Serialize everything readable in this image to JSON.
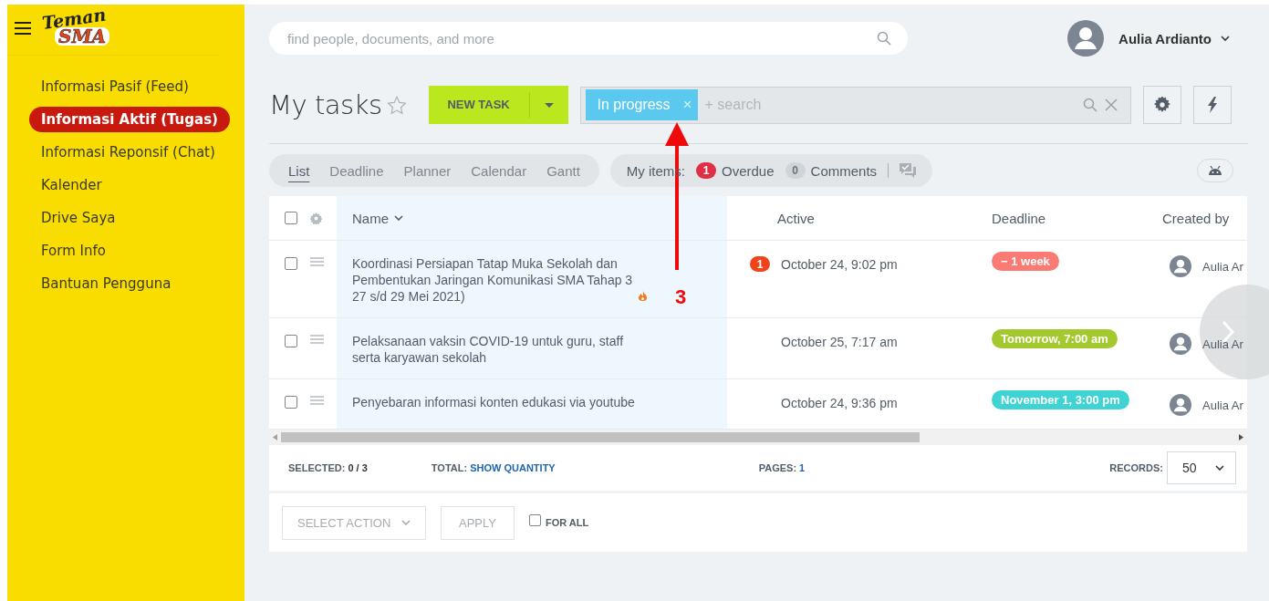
{
  "logo": {
    "line_1": "Teman",
    "line_2": "SMA"
  },
  "sidebar": {
    "items": [
      {
        "label": "Informasi Pasif (Feed)",
        "selected": false
      },
      {
        "label": "Informasi Aktif (Tugas)",
        "selected": true
      },
      {
        "label": "Informasi Reponsif (Chat)",
        "selected": false
      },
      {
        "label": "Kalender",
        "selected": false
      },
      {
        "label": "Drive Saya",
        "selected": false
      },
      {
        "label": "Form Info",
        "selected": false
      },
      {
        "label": "Bantuan Pengguna",
        "selected": false
      }
    ]
  },
  "search": {
    "placeholder": "find people, documents, and more"
  },
  "user": {
    "name": "Aulia Ardianto"
  },
  "page_title": "My tasks",
  "new_task_button": "NEW TASK",
  "filter": {
    "chip": "In progress",
    "chip_close": "×",
    "placeholder": "+ search"
  },
  "view_tabs": [
    {
      "label": "List",
      "selected": true
    },
    {
      "label": "Deadline",
      "selected": false
    },
    {
      "label": "Planner",
      "selected": false
    },
    {
      "label": "Calendar",
      "selected": false
    },
    {
      "label": "Gantt",
      "selected": false
    }
  ],
  "my_items": {
    "label": "My items:",
    "counters": [
      {
        "count": "1",
        "label": "Overdue",
        "kind": "alert"
      },
      {
        "count": "0",
        "label": "Comments",
        "kind": "plain"
      }
    ]
  },
  "table": {
    "all_checked": false,
    "columns": [
      "Name",
      "Active",
      "Deadline",
      "Created by"
    ],
    "rows": [
      {
        "checked": false,
        "name": "Koordinasi Persiapan Tatap Muka Sekolah dan Pembentukan Jaringan Komunikasi SMA Tahap 3 27 s/d 29 Mei 2021)",
        "hot": true,
        "badge": "1",
        "active": "October 24, 9:02 pm",
        "deadline": "− 1 week",
        "color": "#fb7a74",
        "created_by": "Aulia Ar"
      },
      {
        "checked": false,
        "name": "Pelaksanaan vaksin COVID-19 untuk guru, staff serta karyawan sekolah",
        "hot": false,
        "active": "October 25, 7:17 am",
        "deadline": "Tomorrow, 7:00 am",
        "color": "#a4c92f",
        "created_by": "Aulia Ar"
      },
      {
        "checked": false,
        "name": "Penyebaran informasi konten edukasi via youtube",
        "hot": false,
        "active": "October 24, 9:36 pm",
        "deadline": "November 1, 3:00 pm",
        "color": "#3fd3d3",
        "created_by": "Aulia Ar"
      }
    ]
  },
  "footer": {
    "selected_label": "SELECTED:",
    "selected_value": "0 / 3",
    "total_label": "TOTAL:",
    "total_link": "SHOW QUANTITY",
    "pages_label": "PAGES:",
    "pages_value": "1",
    "records_label": "RECORDS:",
    "records_value": "50"
  },
  "actions": {
    "select_action": "SELECT ACTION",
    "apply": "APPLY",
    "for_all": "FOR ALL",
    "for_all_checked": false
  },
  "annotation": {
    "label": "3"
  }
}
